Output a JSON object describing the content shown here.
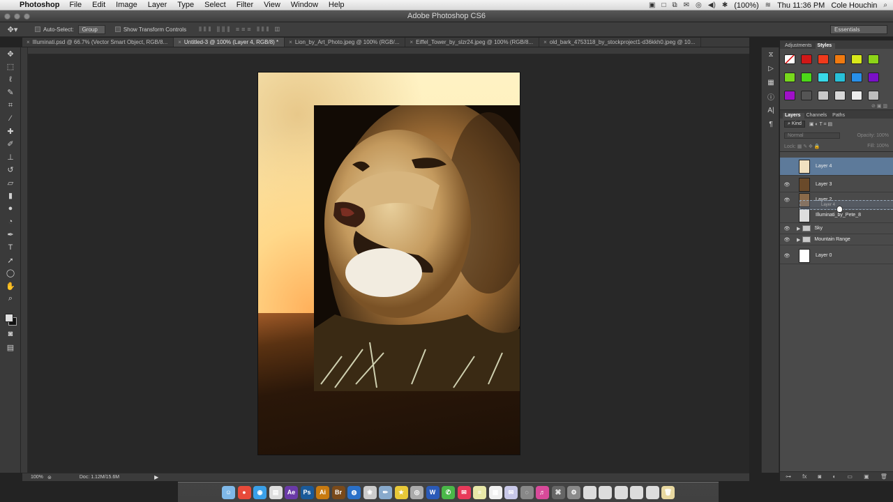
{
  "menubar": {
    "app_name": "Photoshop",
    "items": [
      "File",
      "Edit",
      "Image",
      "Layer",
      "Type",
      "Select",
      "Filter",
      "View",
      "Window",
      "Help"
    ],
    "battery": "(100%)",
    "clock": "Thu 11:36 PM",
    "user": "Cole Houchin"
  },
  "window": {
    "title": "Adobe Photoshop CS6"
  },
  "options": {
    "auto_select_label": "Auto-Select:",
    "auto_select_value": "Group",
    "show_transform_label": "Show Transform Controls",
    "workspace": "Essentials"
  },
  "tabs": [
    {
      "label": "Illuminati.psd @ 66.7% (Vector Smart Object, RGB/8...",
      "active": false
    },
    {
      "label": "Untitled-3 @ 100% (Layer 4, RGB/8) *",
      "active": true
    },
    {
      "label": "Lion_by_Art_Photo.jpeg @ 100% (RGB/...",
      "active": false
    },
    {
      "label": "Eiffel_Tower_by_slzr24.jpeg @ 100% (RGB/8...",
      "active": false
    },
    {
      "label": "old_bark_4753118_by_stockproject1-d36kkh0.jpeg @ 10...",
      "active": false
    }
  ],
  "statusbar": {
    "zoom": "100%",
    "doc": "Doc: 1.12M/15.6M"
  },
  "panels": {
    "top_tabs": [
      "Adjustments",
      "Styles"
    ],
    "layer_tabs": [
      "Layers",
      "Channels",
      "Paths"
    ],
    "kind": "Kind",
    "blend_mode": "Normal",
    "opacity_label": "Opacity:",
    "opacity_value": "100%",
    "lock_label": "Lock:",
    "fill_label": "Fill:",
    "fill_value": "100%",
    "style_colors": [
      "none",
      "#d01818",
      "#f03a1c",
      "#f07a10",
      "#d8e81a",
      "#8cd418",
      "#78d81c",
      "#4cd818",
      "#38d8e8",
      "#28c0d8",
      "#2890e8",
      "#7a10c8",
      "#a010c8",
      "#555555",
      "#c8c8c8",
      "#d8d8d8",
      "#ececec",
      "#bcbcbc"
    ]
  },
  "layers": [
    {
      "name": "Layer 4",
      "visible": false,
      "selected": true,
      "folder": false
    },
    {
      "name": "Layer 3",
      "visible": true,
      "selected": false,
      "folder": false
    },
    {
      "name": "Layer 2",
      "visible": true,
      "selected": false,
      "folder": false
    },
    {
      "name": "Illuminati_by_Pete_8",
      "visible": false,
      "selected": false,
      "folder": false
    },
    {
      "name": "Sky",
      "visible": true,
      "selected": false,
      "folder": true
    },
    {
      "name": "Mountain Range",
      "visible": true,
      "selected": false,
      "folder": true
    },
    {
      "name": "Layer 0",
      "visible": true,
      "selected": false,
      "folder": false
    }
  ],
  "drag_ghost_label": "Layer 4",
  "dock_icons": [
    "Finder",
    "Chrome",
    "Safari",
    "Preview",
    "Ae",
    "Ps",
    "Ai",
    "Br",
    "Globe",
    "Photos",
    "Pencil",
    "Star",
    "Camera",
    "Word",
    "Messages",
    "Stamp",
    "Notes",
    "Calendar",
    "Mail",
    "Disc",
    "Game",
    "Gamepad",
    "Preferences",
    "Folder",
    "Folder",
    "Folder",
    "Folder",
    "Folder",
    "Trash"
  ]
}
